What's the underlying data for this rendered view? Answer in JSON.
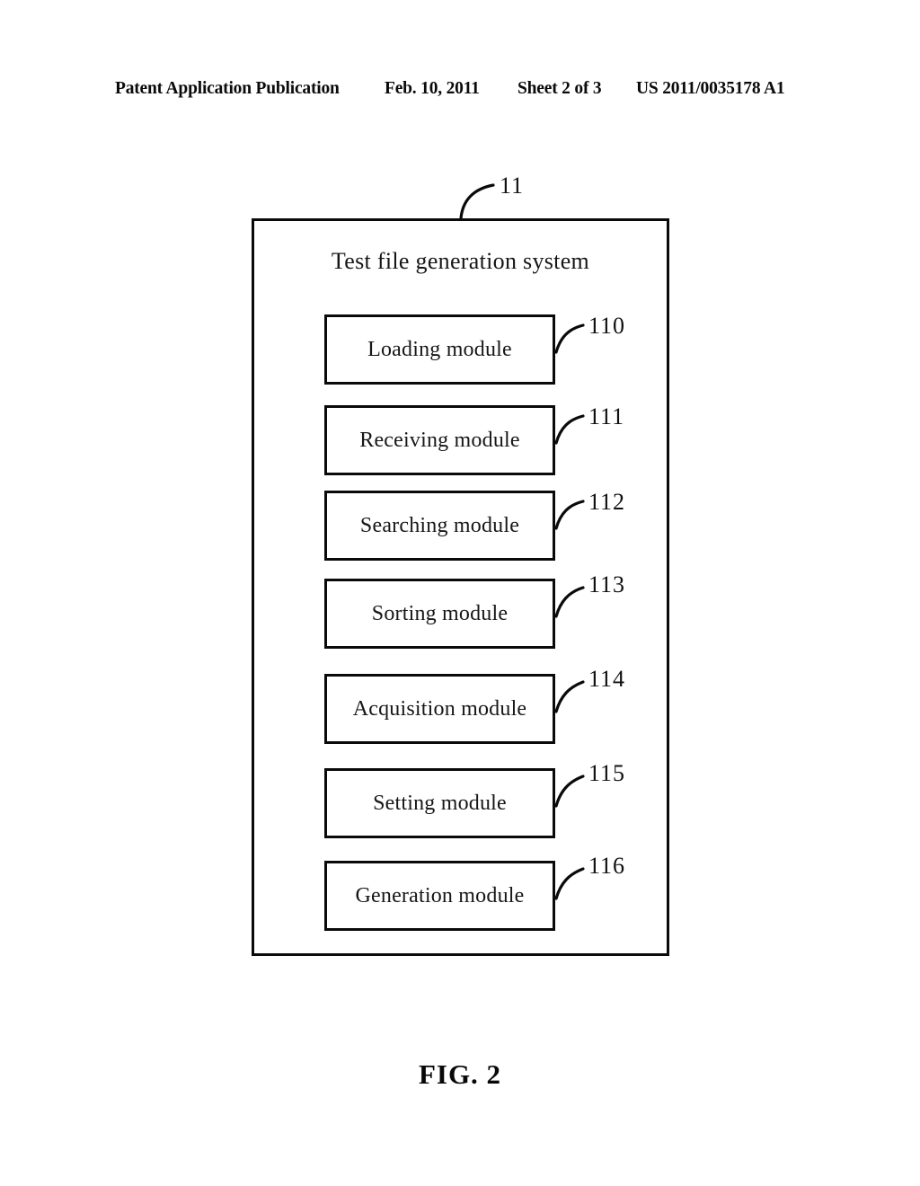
{
  "header": {
    "publication": "Patent Application Publication",
    "date": "Feb. 10, 2011",
    "sheet": "Sheet 2 of 3",
    "publication_number": "US 2011/0035178 A1"
  },
  "figure": {
    "caption": "FIG. 2",
    "system": {
      "title": "Test file generation system",
      "reference_numeral": "11"
    },
    "modules": [
      {
        "label": "Loading module",
        "reference_numeral": "110"
      },
      {
        "label": "Receiving module",
        "reference_numeral": "111"
      },
      {
        "label": "Searching module",
        "reference_numeral": "112"
      },
      {
        "label": "Sorting module",
        "reference_numeral": "113"
      },
      {
        "label": "Acquisition module",
        "reference_numeral": "114"
      },
      {
        "label": "Setting module",
        "reference_numeral": "115"
      },
      {
        "label": "Generation module",
        "reference_numeral": "116"
      }
    ]
  },
  "colors": {
    "ink": "#0a0a0a",
    "paper": "#ffffff"
  }
}
